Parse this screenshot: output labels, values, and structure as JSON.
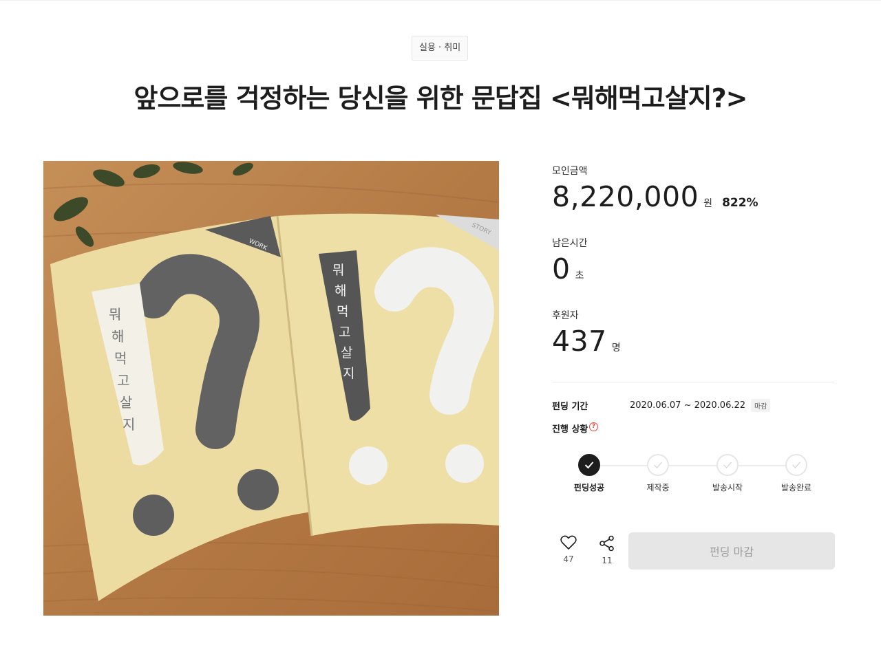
{
  "category": "실용 · 취미",
  "title": "앞으로를 걱정하는 당신을 위한 문답집 <뭐해먹고살지?>",
  "image": {
    "book_text": "뭐해먹고살지",
    "tab_left": "WORK",
    "tab_right": "STORY"
  },
  "stats": {
    "raised_label": "모인금액",
    "raised_value": "8,220,000",
    "raised_unit": "원",
    "raised_percent": "822%",
    "remaining_label": "남은시간",
    "remaining_value": "0",
    "remaining_unit": "초",
    "backers_label": "후원자",
    "backers_value": "437",
    "backers_unit": "명"
  },
  "info": {
    "period_label": "펀딩 기간",
    "period_value": "2020.06.07 ~ 2020.06.22",
    "period_badge": "마감",
    "status_label": "진행 상황",
    "help_glyph": "?"
  },
  "steps": [
    {
      "label": "펀딩성공",
      "done": true
    },
    {
      "label": "제작중",
      "done": false
    },
    {
      "label": "발송시작",
      "done": false
    },
    {
      "label": "발송완료",
      "done": false
    }
  ],
  "actions": {
    "like_icon": "heart-icon",
    "like_count": "47",
    "share_icon": "share-icon",
    "share_count": "11",
    "cta_label": "펀딩 마감"
  },
  "colors": {
    "text": "#1d1d1d",
    "cta_bg": "#e6e6e6",
    "cta_text": "#9a9a9a",
    "help": "#e04a3a",
    "cover": "#ecdca2",
    "wood": "#b9824d"
  }
}
